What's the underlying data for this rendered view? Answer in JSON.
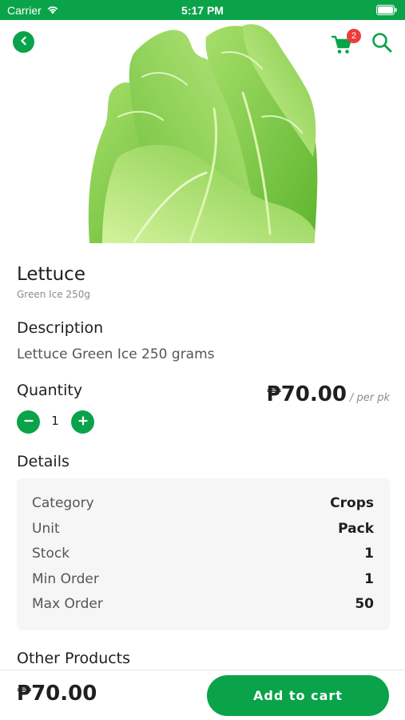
{
  "status_bar": {
    "carrier": "Carrier",
    "time": "5:17 PM"
  },
  "nav": {
    "cart_count": "2",
    "icons": [
      "back-arrow-icon",
      "cart-icon",
      "search-icon"
    ]
  },
  "product": {
    "name": "Lettuce",
    "variant": "Green Ice 250g",
    "description_heading": "Description",
    "description": "Lettuce Green Ice 250 grams",
    "quantity_heading": "Quantity",
    "quantity": "1",
    "price": "₱70.00",
    "price_unit": "/ per pk"
  },
  "details": {
    "heading": "Details",
    "rows": [
      {
        "label": "Category",
        "value": "Crops"
      },
      {
        "label": "Unit",
        "value": "Pack"
      },
      {
        "label": "Stock",
        "value": "1"
      },
      {
        "label": "Min Order",
        "value": "1"
      },
      {
        "label": "Max Order",
        "value": "50"
      }
    ]
  },
  "other_products": {
    "heading": "Other Products"
  },
  "bottom_bar": {
    "price": "₱70.00",
    "add_to_cart_label": "Add to cart"
  },
  "colors": {
    "brand_green": "#0aa34a",
    "badge_red": "#ee3b3b",
    "card_background": "#f6f6f6"
  }
}
